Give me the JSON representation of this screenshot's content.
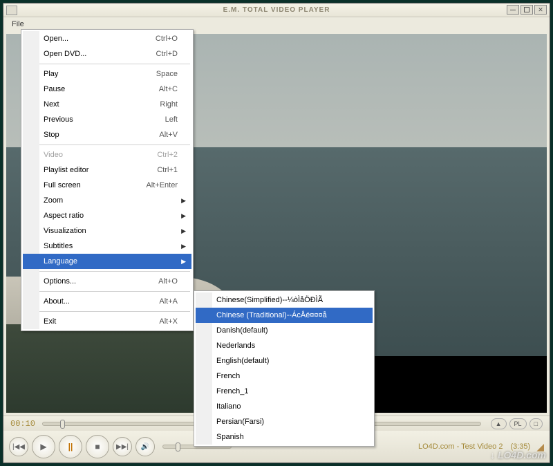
{
  "app": {
    "title": "E.M. TOTAL VIDEO PLAYER",
    "menubar": {
      "file": "File"
    }
  },
  "playback": {
    "time": "00:10",
    "status": "LO4D.com - Test Video 2",
    "duration": "(3:35)",
    "pill_eject": "▲",
    "pill_pl": "PL",
    "pill_eq": "□"
  },
  "controls": {
    "prev": "|◀◀",
    "play": "▶",
    "pause": "||",
    "stop": "■",
    "next": "▶▶|",
    "mute": "🔊"
  },
  "menu": {
    "items": [
      {
        "label": "Open...",
        "shortcut": "Ctrl+O"
      },
      {
        "label": "Open DVD...",
        "shortcut": "Ctrl+D"
      },
      {
        "sep": true
      },
      {
        "label": "Play",
        "shortcut": "Space"
      },
      {
        "label": "Pause",
        "shortcut": "Alt+C"
      },
      {
        "label": "Next",
        "shortcut": "Right"
      },
      {
        "label": "Previous",
        "shortcut": "Left"
      },
      {
        "label": "Stop",
        "shortcut": "Alt+V"
      },
      {
        "sep": true
      },
      {
        "label": "Video",
        "shortcut": "Ctrl+2",
        "disabled": true
      },
      {
        "label": "Playlist editor",
        "shortcut": "Ctrl+1"
      },
      {
        "label": "Full screen",
        "shortcut": "Alt+Enter"
      },
      {
        "label": "Zoom",
        "submenu": true
      },
      {
        "label": "Aspect ratio",
        "submenu": true
      },
      {
        "label": "Visualization",
        "submenu": true
      },
      {
        "label": "Subtitles",
        "submenu": true
      },
      {
        "label": "Language",
        "submenu": true,
        "highlight": true
      },
      {
        "sep": true
      },
      {
        "label": "Options...",
        "shortcut": "Alt+O"
      },
      {
        "sep": true
      },
      {
        "label": "About...",
        "shortcut": "Alt+A"
      },
      {
        "sep": true
      },
      {
        "label": "Exit",
        "shortcut": "Alt+X"
      }
    ]
  },
  "submenu": {
    "items": [
      {
        "label": "Chinese(Simplified)--¼òÌåÖÐÌÃ"
      },
      {
        "label": "Chinese (Traditional)--ÁcÅé¤¤¤å",
        "highlight": true
      },
      {
        "label": "Danish(default)"
      },
      {
        "label": "Nederlands"
      },
      {
        "label": "English(default)"
      },
      {
        "label": "French"
      },
      {
        "label": "French_1"
      },
      {
        "label": "Italiano"
      },
      {
        "label": "Persian(Farsi)"
      },
      {
        "label": "Spanish"
      }
    ]
  },
  "watermark": "↓ LO4D.com"
}
